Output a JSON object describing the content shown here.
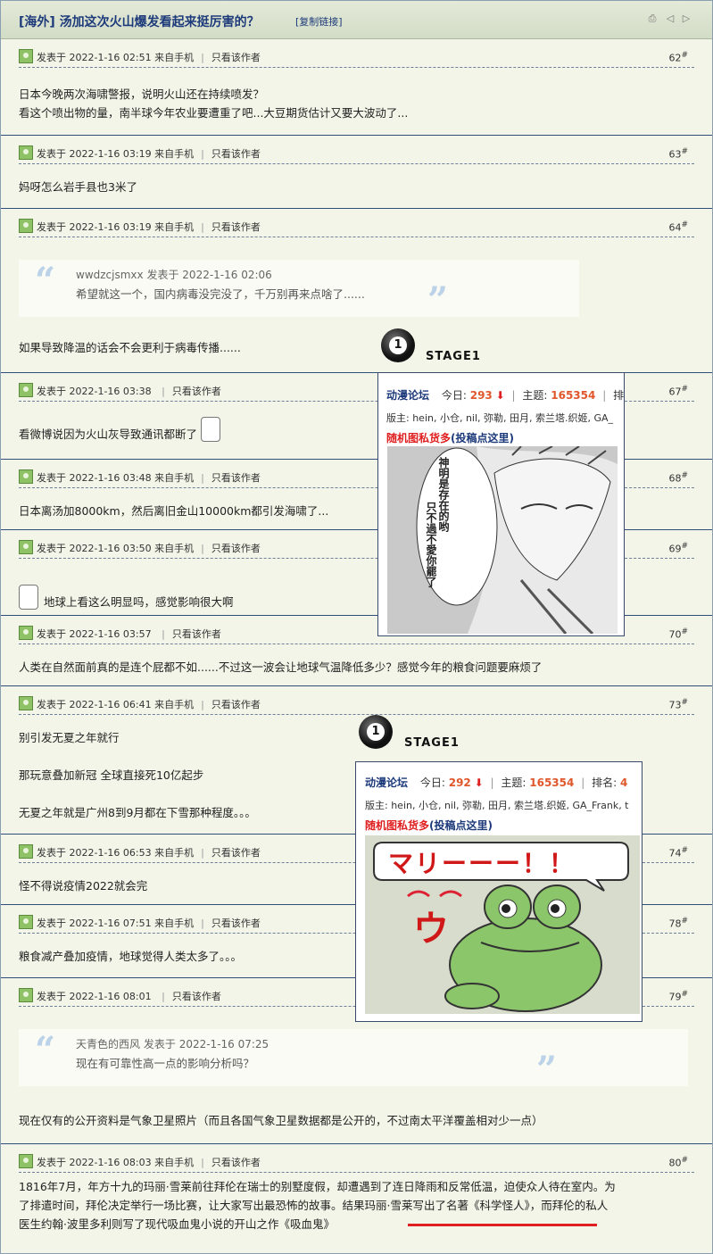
{
  "thread": {
    "title": "[海外] 汤加这次火山爆发看起来挺厉害的？",
    "copy_link": "[复制链接]"
  },
  "labels": {
    "posted_prefix": "发表于",
    "only_author": "只看该作者",
    "from_mobile": "来自手机",
    "floor_mark": "#"
  },
  "posts": [
    {
      "time": "2022-1-16 02:51",
      "mobile": true,
      "floor": "62",
      "lines": [
        "日本今晚两次海啸警报，说明火山还在持续喷发？",
        "看这个喷出物的量，南半球今年农业要遭重了吧...大豆期货估计又要大波动了..."
      ]
    },
    {
      "time": "2022-1-16 03:19",
      "mobile": true,
      "floor": "63",
      "lines": [
        "妈呀怎么岩手县也3米了"
      ]
    },
    {
      "time": "2022-1-16 03:19",
      "mobile": true,
      "floor": "64",
      "quote": {
        "author": "wwdzcjsmxx",
        "time": "2022-1-16 02:06",
        "text": "希望就这一个，国内病毒没完没了，千万别再来点啥了......"
      },
      "lines": [
        "如果导致降温的话会不会更利于病毒传播......"
      ]
    },
    {
      "time": "2022-1-16 03:38",
      "mobile": false,
      "floor": "67",
      "lines": [
        "看微博说因为火山灰导致通讯都断了"
      ]
    },
    {
      "time": "2022-1-16 03:48",
      "mobile": true,
      "floor": "68",
      "lines": [
        "日本离汤加8000km，然后离旧金山10000km都引发海啸了..."
      ]
    },
    {
      "time": "2022-1-16 03:50",
      "mobile": true,
      "floor": "69",
      "lines": [
        "地球上看这么明显吗，感觉影响很大啊"
      ]
    },
    {
      "time": "2022-1-16 03:57",
      "mobile": false,
      "floor": "70",
      "lines": [
        "人类在自然面前真的是连个屁都不如......不过这一波会让地球气温降低多少？感觉今年的粮食问题要麻烦了"
      ]
    },
    {
      "time": "2022-1-16 06:41",
      "mobile": true,
      "floor": "73",
      "lines": [
        "别引发无夏之年就行",
        "",
        "那玩意叠加新冠 全球直接死10亿起步",
        "",
        "无夏之年就是广州8到9月都在下雪那种程度。。。"
      ]
    },
    {
      "time": "2022-1-16 06:53",
      "mobile": true,
      "floor": "74",
      "lines": [
        "怪不得说疫情2022就会完"
      ]
    },
    {
      "time": "2022-1-16 07:51",
      "mobile": true,
      "floor": "78",
      "lines": [
        "粮食减产叠加疫情，地球觉得人类太多了。。。"
      ]
    },
    {
      "time": "2022-1-16 08:01",
      "mobile": false,
      "floor": "79",
      "quote": {
        "author": "天青色的西风",
        "time": "2022-1-16 07:25",
        "text": "现在有可靠性高一点的影响分析吗？"
      },
      "lines": [
        "现在仅有的公开资料是气象卫星照片（而且各国气象卫星数据都是公开的，不过南太平洋覆盖相对少一点）"
      ]
    },
    {
      "time": "2022-1-16 08:03",
      "mobile": true,
      "floor": "80",
      "lines": [
        "1816年7月，年方十九的玛丽·雪莱前往拜伦在瑞士的别墅度假，却遭遇到了连日降雨和反常低温，迫使众人待在室内。为",
        "了排遣时间，拜伦决定举行一场比赛，让大家写出最恐怖的故事。结果玛丽·雪莱写出了名著《科学怪人》，而拜伦的私人",
        "医生约翰·波里多利则写了现代吸血鬼小说的开山之作《吸血鬼》"
      ]
    }
  ],
  "overlays": [
    {
      "stage": "STAGE1",
      "ball_number": "1",
      "forum": "动漫论坛",
      "today_label": "今日:",
      "today": "293",
      "topics_label": "主题:",
      "topics": "165354",
      "rank_label": "排",
      "mods": "版主: hein, 小仓, nil, 弥勒, 田月, 索兰塔.织姬, GA_",
      "random_pic": "随机图私货多",
      "submit": "(投稿点这里)",
      "manga_text_1": "神明是存在的哟",
      "manga_text_2": "只不過不愛你罷了"
    },
    {
      "stage": "STAGE1",
      "ball_number": "1",
      "forum": "动漫论坛",
      "today_label": "今日:",
      "today": "292",
      "topics_label": "主题:",
      "topics": "165354",
      "rank_label": "排名:",
      "rank": "4",
      "mods": "版主: hein, 小仓, nil, 弥勒, 田月, 索兰塔.织姬, GA_Frank, t",
      "random_pic": "随机图私货多",
      "submit": "(投稿点这里)",
      "bubble": "マリーーー！！",
      "kana": "ウ"
    }
  ],
  "colors": {
    "accent_red": "#e0572b",
    "link_blue": "#1d3a7a",
    "frog_green": "#8cc66a"
  }
}
